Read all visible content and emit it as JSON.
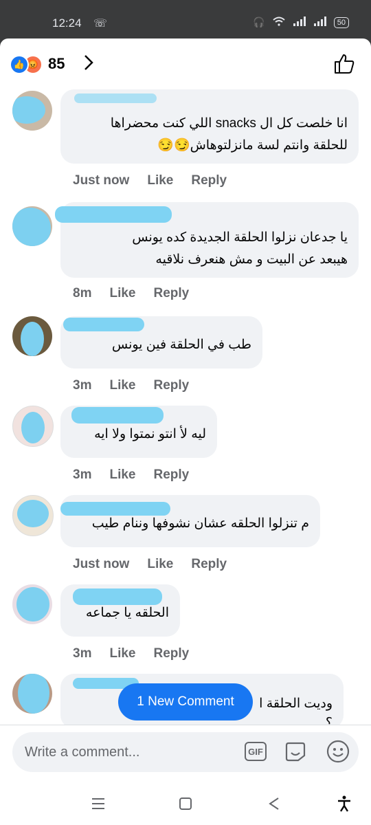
{
  "status": {
    "time": "12:24",
    "battery": "50"
  },
  "reactions": {
    "count": "85"
  },
  "comments": [
    {
      "text": "انا خلصت كل ال snacks اللي كنت محضراها\nللحلقة وانتم لسة مانزلتوهاش😏😏",
      "time": "Just now",
      "like": "Like",
      "reply": "Reply"
    },
    {
      "text": "يا جدعان نزلوا الحلقة الجديدة كده يونس\nهيبعد عن البيت و مش هنعرف نلاقيه",
      "time": "8m",
      "like": "Like",
      "reply": "Reply"
    },
    {
      "text": "طب في الحلقة فين يونس",
      "time": "3m",
      "like": "Like",
      "reply": "Reply"
    },
    {
      "text": "ليه لأ انتو نمتوا ولا ايه",
      "time": "3m",
      "like": "Like",
      "reply": "Reply"
    },
    {
      "text": "م تنزلوا الحلقه عشان نشوفها وننام طيب",
      "time": "Just now",
      "like": "Like",
      "reply": "Reply"
    },
    {
      "text": "الحلقه يا جماعه",
      "time": "3m",
      "like": "Like",
      "reply": "Reply"
    },
    {
      "text": "وديت الحلقة ا\n؟",
      "time": "",
      "like": "",
      "reply": ""
    }
  ],
  "new_comment_label": "1 New Comment",
  "composer": {
    "placeholder": "Write a comment...",
    "gif_label": "GIF"
  },
  "colors": {
    "accent": "#1877f2",
    "bubble": "#f0f2f5",
    "meta": "#65676b",
    "redaction": "#7fd3f3"
  }
}
